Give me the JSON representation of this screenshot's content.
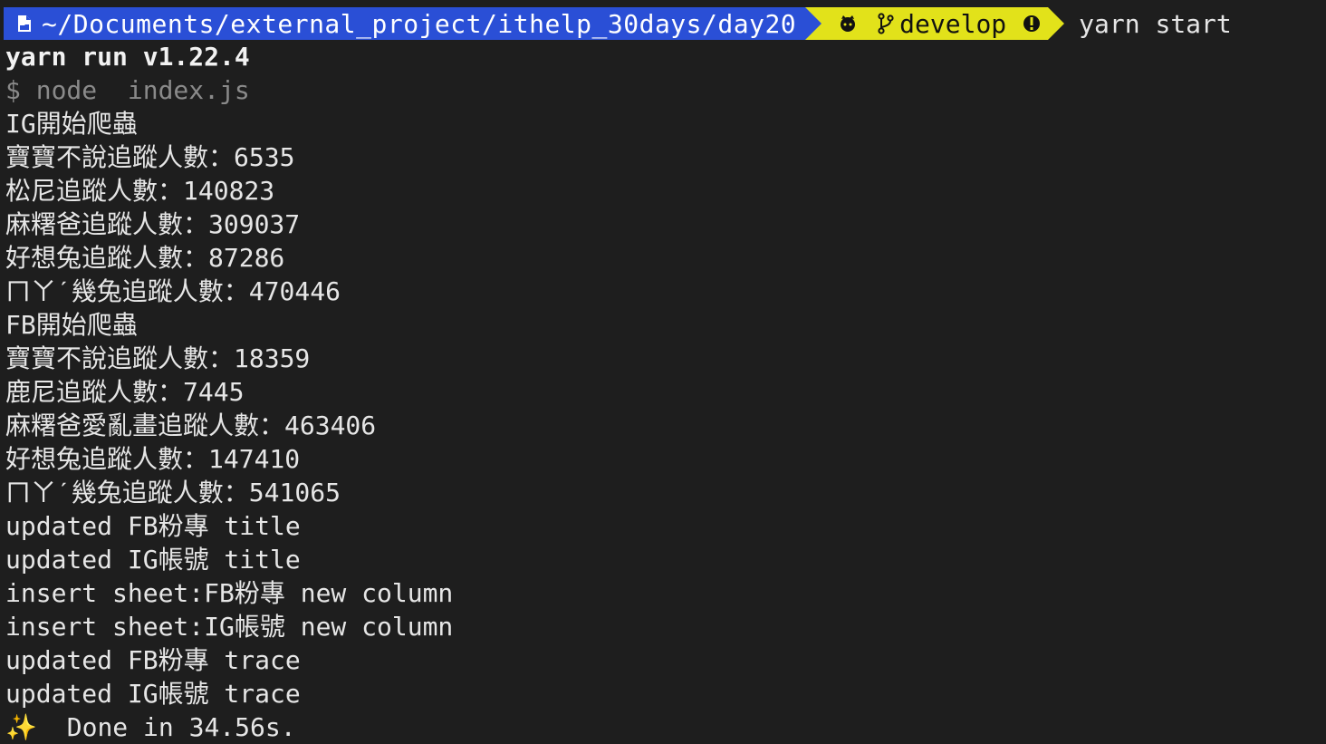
{
  "prompt": {
    "path": "~/Documents/external_project/ithelp_30days/day20",
    "branch": "develop",
    "command": "yarn start",
    "icons": {
      "folder": "folder-icon",
      "github": "github-icon",
      "branch": "git-branch-icon",
      "status": "exclamation-icon"
    },
    "colors": {
      "path_bg": "#2a4fd6",
      "git_bg": "#e2e21a"
    }
  },
  "output": {
    "yarn_version": "yarn run v1.22.4",
    "run_cmd": "$ node  index.js",
    "lines": [
      "IG開始爬蟲",
      "寶寶不說追蹤人數：6535",
      "松尼追蹤人數：140823",
      "麻糬爸追蹤人數：309037",
      "好想兔追蹤人數：87286",
      "ㄇㄚˊ幾兔追蹤人數：470446",
      "FB開始爬蟲",
      "寶寶不說追蹤人數：18359",
      "鹿尼追蹤人數：7445",
      "麻糬爸愛亂畫追蹤人數：463406",
      "好想兔追蹤人數：147410",
      "ㄇㄚˊ幾兔追蹤人數：541065",
      "updated FB粉專 title",
      "updated IG帳號 title",
      "insert sheet:FB粉專 new column",
      "insert sheet:IG帳號 new column",
      "updated FB粉專 trace",
      "updated IG帳號 trace"
    ],
    "done_icon": "sparkles-icon",
    "done": " Done in 34.56s."
  }
}
